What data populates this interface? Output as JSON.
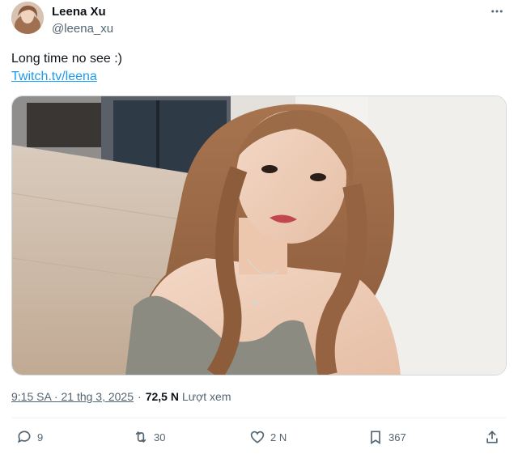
{
  "author": {
    "name": "Leena Xu",
    "handle": "@leena_xu"
  },
  "tweet": {
    "text": "Long time no see :)",
    "link": "Twitch.tv/leena"
  },
  "meta": {
    "time": "9:15 SA · 21 thg 3, 2025",
    "separator": "·",
    "views_count": "72,5 N",
    "views_label": "Lượt xem"
  },
  "actions": {
    "reply_count": "9",
    "retweet_count": "30",
    "like_count": "2 N",
    "bookmark_count": "367"
  },
  "icons": {
    "more": "more-icon",
    "reply": "reply-icon",
    "retweet": "retweet-icon",
    "like": "heart-icon",
    "bookmark": "bookmark-icon",
    "share": "share-icon"
  },
  "colors": {
    "link": "#1d9bf0",
    "secondary_text": "#536471",
    "primary_text": "#0f1419"
  }
}
